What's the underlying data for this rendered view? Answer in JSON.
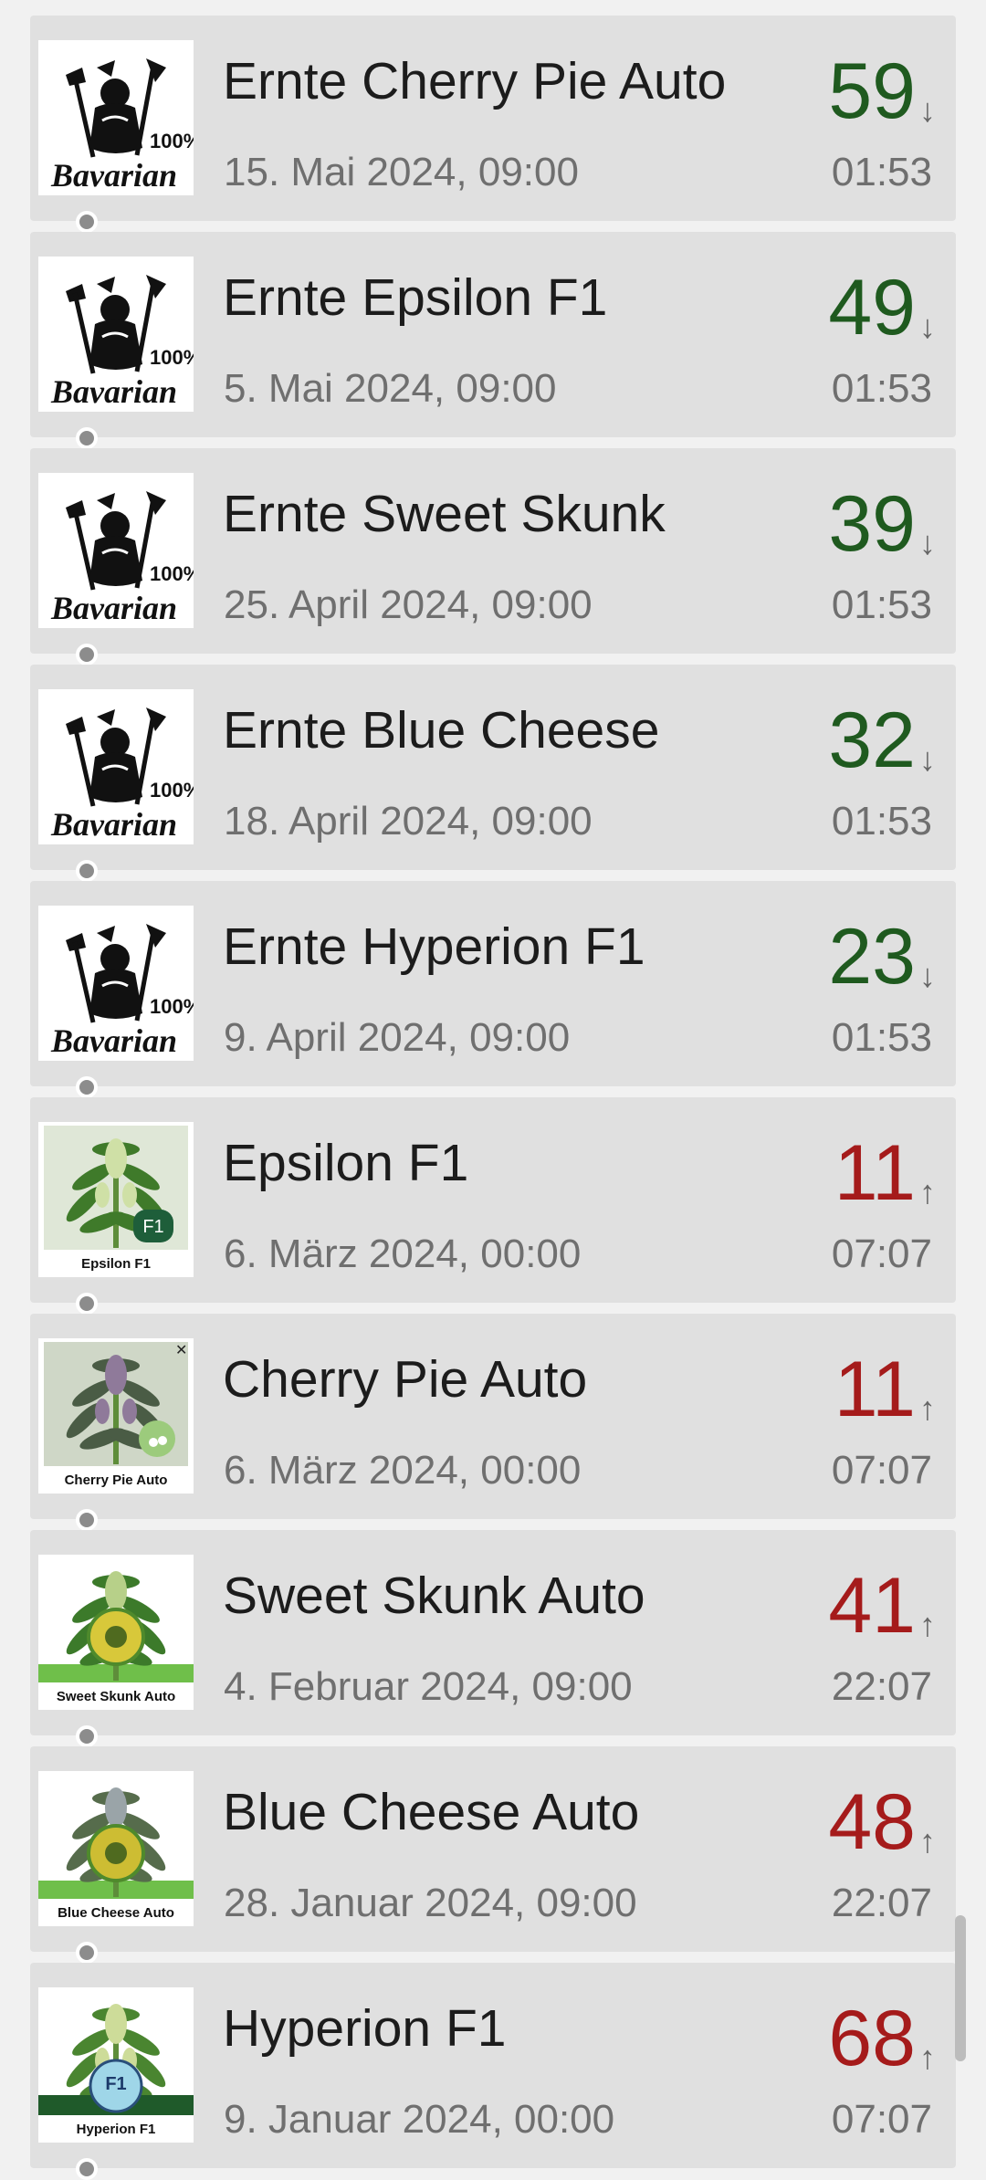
{
  "colors": {
    "row_bg": "#e0e0e0",
    "page_bg": "#f1f1f1",
    "count_down": "#1f5a1f",
    "count_up": "#a51b1b",
    "secondary_text": "#6f6f6f"
  },
  "items": [
    {
      "title": "Ernte Cherry Pie Auto",
      "date": "15. Mai 2024, 09:00",
      "count": "59",
      "arrow": "↓",
      "trend": "down",
      "time": "01:53",
      "thumb": "bavarian",
      "thumb_label": "",
      "thumb_icon": "bavarian-logo-icon"
    },
    {
      "title": "Ernte Epsilon F1",
      "date": "5. Mai 2024, 09:00",
      "count": "49",
      "arrow": "↓",
      "trend": "down",
      "time": "01:53",
      "thumb": "bavarian",
      "thumb_label": "",
      "thumb_icon": "bavarian-logo-icon"
    },
    {
      "title": "Ernte Sweet Skunk",
      "date": "25. April 2024, 09:00",
      "count": "39",
      "arrow": "↓",
      "trend": "down",
      "time": "01:53",
      "thumb": "bavarian",
      "thumb_label": "",
      "thumb_icon": "bavarian-logo-icon"
    },
    {
      "title": "Ernte Blue Cheese",
      "date": "18. April 2024, 09:00",
      "count": "32",
      "arrow": "↓",
      "trend": "down",
      "time": "01:53",
      "thumb": "bavarian",
      "thumb_label": "",
      "thumb_icon": "bavarian-logo-icon"
    },
    {
      "title": "Ernte Hyperion F1",
      "date": "9. April 2024, 09:00",
      "count": "23",
      "arrow": "↓",
      "trend": "down",
      "time": "01:53",
      "thumb": "bavarian",
      "thumb_label": "",
      "thumb_icon": "bavarian-logo-icon"
    },
    {
      "title": "Epsilon F1",
      "date": "6. März 2024, 00:00",
      "count": "11",
      "arrow": "↑",
      "trend": "up",
      "time": "07:07",
      "thumb": "epsilon",
      "thumb_label": "Epsilon F1",
      "thumb_icon": "cannabis-plant-icon"
    },
    {
      "title": "Cherry Pie Auto",
      "date": "6. März 2024, 00:00",
      "count": "11",
      "arrow": "↑",
      "trend": "up",
      "time": "07:07",
      "thumb": "cherry",
      "thumb_label": "Cherry Pie Auto",
      "thumb_icon": "cannabis-plant-icon"
    },
    {
      "title": "Sweet Skunk Auto",
      "date": "4. Februar 2024, 09:00",
      "count": "41",
      "arrow": "↑",
      "trend": "up",
      "time": "22:07",
      "thumb": "skunk",
      "thumb_label": "Sweet Skunk Auto",
      "thumb_icon": "cannabis-plant-icon"
    },
    {
      "title": "Blue Cheese Auto",
      "date": "28. Januar 2024, 09:00",
      "count": "48",
      "arrow": "↑",
      "trend": "up",
      "time": "22:07",
      "thumb": "cheese",
      "thumb_label": "Blue Cheese Auto",
      "thumb_icon": "cannabis-plant-icon"
    },
    {
      "title": "Hyperion F1",
      "date": "9. Januar 2024, 00:00",
      "count": "68",
      "arrow": "↑",
      "trend": "up",
      "time": "07:07",
      "thumb": "hyperion",
      "thumb_label": "Hyperion F1",
      "thumb_icon": "cannabis-plant-icon"
    }
  ],
  "scrollbar": {
    "visible": true
  }
}
